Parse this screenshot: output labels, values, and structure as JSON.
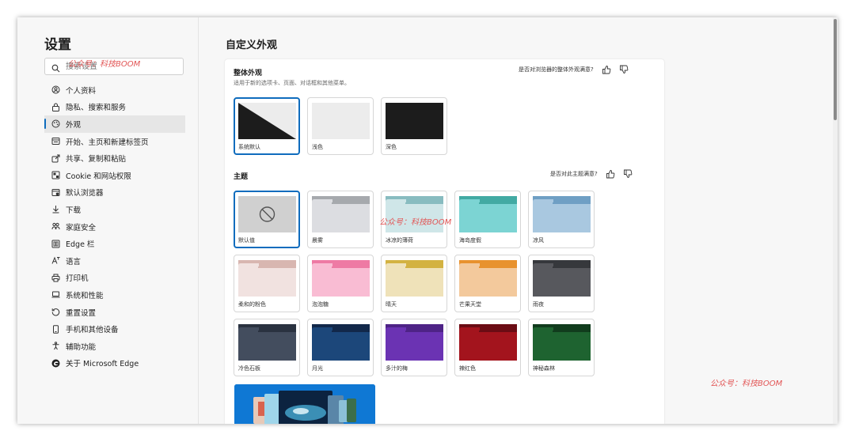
{
  "sidebar": {
    "title": "设置",
    "search_placeholder": "搜索设置",
    "items": [
      {
        "label": "个人资料",
        "icon": "profile-icon"
      },
      {
        "label": "隐私、搜索和服务",
        "icon": "lock-icon"
      },
      {
        "label": "外观",
        "icon": "appearance-icon",
        "active": true
      },
      {
        "label": "开始、主页和新建标签页",
        "icon": "home-tab-icon"
      },
      {
        "label": "共享、复制和粘贴",
        "icon": "share-icon"
      },
      {
        "label": "Cookie 和网站权限",
        "icon": "cookie-icon"
      },
      {
        "label": "默认浏览器",
        "icon": "browser-icon"
      },
      {
        "label": "下载",
        "icon": "download-icon"
      },
      {
        "label": "家庭安全",
        "icon": "family-icon"
      },
      {
        "label": "Edge 栏",
        "icon": "edge-bar-icon"
      },
      {
        "label": "语言",
        "icon": "language-icon"
      },
      {
        "label": "打印机",
        "icon": "printer-icon"
      },
      {
        "label": "系统和性能",
        "icon": "system-icon"
      },
      {
        "label": "重置设置",
        "icon": "reset-icon"
      },
      {
        "label": "手机和其他设备",
        "icon": "phone-icon"
      },
      {
        "label": "辅助功能",
        "icon": "accessibility-icon"
      },
      {
        "label": "关于 Microsoft Edge",
        "icon": "edge-logo-icon"
      }
    ]
  },
  "main": {
    "page_title": "自定义外观",
    "overall": {
      "title": "整体外观",
      "subtitle": "适用于新的选项卡、页面、对话框和其他菜单。",
      "feedback": "是否对浏览器的整体外观满意?",
      "options": [
        {
          "label": "系统默认",
          "selected": true
        },
        {
          "label": "浅色"
        },
        {
          "label": "深色"
        }
      ]
    },
    "theme": {
      "title": "主题",
      "feedback": "是否对此主题满意?",
      "themes": [
        {
          "label": "默认值",
          "selected": true
        },
        {
          "label": "晨雾",
          "top": "#a6a9ad",
          "body": "#dcdde1"
        },
        {
          "label": "冰凉的薄荷",
          "top": "#88bcc0",
          "body": "#cfe6e8"
        },
        {
          "label": "海岛度假",
          "top": "#42aaa3",
          "body": "#7cd4d3"
        },
        {
          "label": "凉风",
          "top": "#6f9fc4",
          "body": "#a9c8e0"
        },
        {
          "label": "柔和的粉色",
          "top": "#d8b6b0",
          "body": "#f1e2e0"
        },
        {
          "label": "泡泡糖",
          "top": "#ee7aa4",
          "body": "#f9bcd3"
        },
        {
          "label": "晴天",
          "top": "#d3b241",
          "body": "#efe2b9"
        },
        {
          "label": "芒果天堂",
          "top": "#e8922e",
          "body": "#f3c99c"
        },
        {
          "label": "雨夜",
          "top": "#36383c",
          "body": "#57585d"
        },
        {
          "label": "冷色石板",
          "top": "#2a3240",
          "body": "#434d5e"
        },
        {
          "label": "月光",
          "top": "#12284a",
          "body": "#1c477a"
        },
        {
          "label": "多汁的梅",
          "top": "#4e2386",
          "body": "#6b33b3"
        },
        {
          "label": "辣红色",
          "top": "#6b0c14",
          "body": "#a3141d"
        },
        {
          "label": "神秘森林",
          "top": "#113c1d",
          "body": "#1e6330"
        }
      ]
    }
  },
  "watermarks": [
    "公众号：科技BOOM",
    "公众号：科技BOOM",
    "公众号：科技BOOM"
  ],
  "colors": {
    "accent": "#0f6cbd",
    "watermark": "#e25656"
  }
}
